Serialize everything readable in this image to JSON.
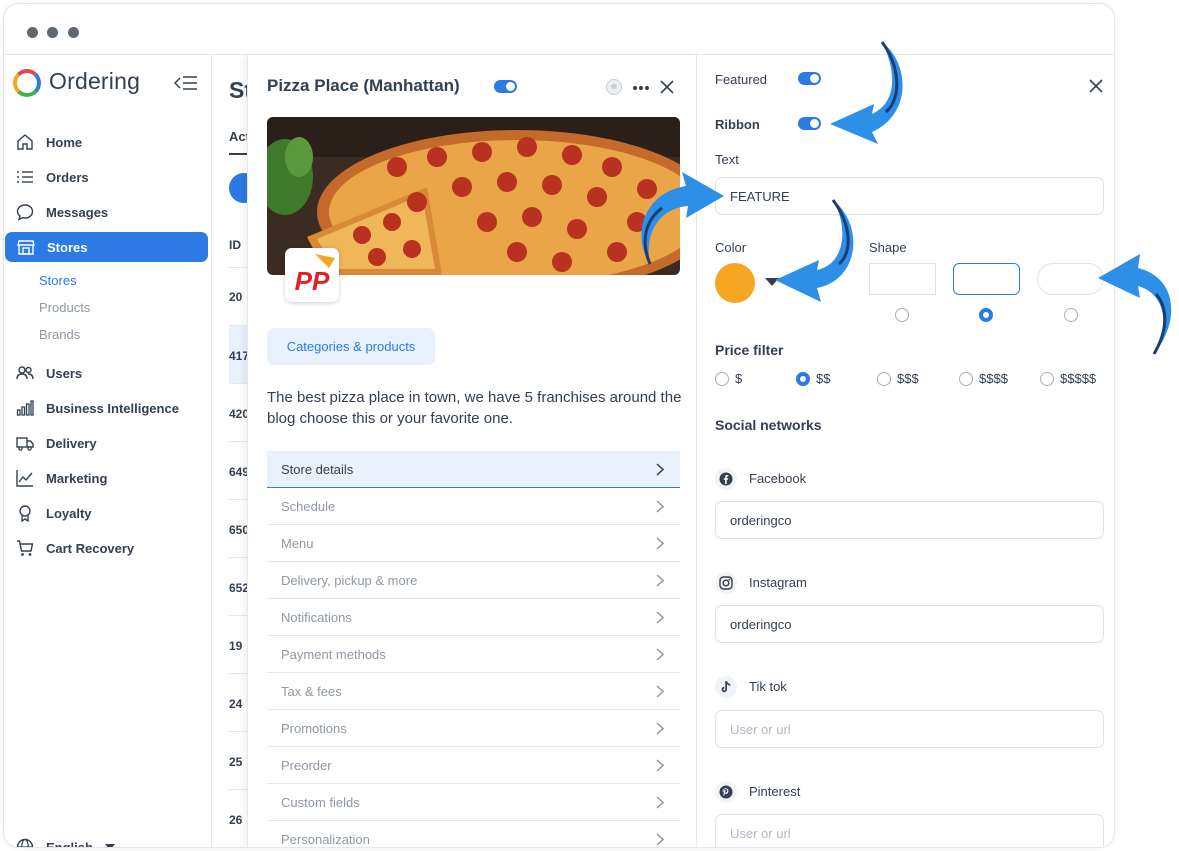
{
  "sidebar": {
    "brand": "Ordering",
    "items": [
      {
        "label": "Home"
      },
      {
        "label": "Orders"
      },
      {
        "label": "Messages"
      },
      {
        "label": "Stores"
      },
      {
        "label": "Users"
      },
      {
        "label": "Business Intelligence"
      },
      {
        "label": "Delivery"
      },
      {
        "label": "Marketing"
      },
      {
        "label": "Loyalty"
      },
      {
        "label": "Cart Recovery"
      }
    ],
    "sub_items": [
      {
        "label": "Stores"
      },
      {
        "label": "Products"
      },
      {
        "label": "Brands"
      }
    ],
    "language": "English"
  },
  "list": {
    "title": "St",
    "tab": "Act",
    "id_header": "ID",
    "ids": [
      "20",
      "417",
      "420",
      "649",
      "650",
      "652",
      "19",
      "24",
      "25",
      "26"
    ]
  },
  "store": {
    "title": "Pizza Place (Manhattan)",
    "logo_text": "PP",
    "categories_button": "Categories & products",
    "description": "The best pizza place in town, we have 5 franchises around the blog choose this or your favorite one.",
    "menu": [
      {
        "label": "Store details"
      },
      {
        "label": "Schedule"
      },
      {
        "label": "Menu"
      },
      {
        "label": "Delivery, pickup & more"
      },
      {
        "label": "Notifications"
      },
      {
        "label": "Payment methods"
      },
      {
        "label": "Tax & fees"
      },
      {
        "label": "Promotions"
      },
      {
        "label": "Preorder"
      },
      {
        "label": "Custom fields"
      },
      {
        "label": "Personalization"
      }
    ]
  },
  "ribbon": {
    "featured_label": "Featured",
    "ribbon_label": "Ribbon",
    "text_label": "Text",
    "text_value": "FEATURE",
    "color_label": "Color",
    "color_value": "#f5a623",
    "shape_label": "Shape",
    "price_filter_label": "Price filter",
    "price_options": [
      "$",
      "$$",
      "$$$",
      "$$$$",
      "$$$$$"
    ],
    "price_selected": "$$",
    "social_label": "Social networks",
    "social": [
      {
        "name": "Facebook",
        "value": "orderingco",
        "placeholder": ""
      },
      {
        "name": "Instagram",
        "value": "orderingco",
        "placeholder": ""
      },
      {
        "name": "Tik tok",
        "value": "",
        "placeholder": "User or url"
      },
      {
        "name": "Pinterest",
        "value": "",
        "placeholder": "User or url"
      }
    ]
  },
  "colors": {
    "accent": "#2c7be5",
    "text": "#344050",
    "muted": "#8f98a3",
    "ribbon_color": "#f5a623"
  }
}
